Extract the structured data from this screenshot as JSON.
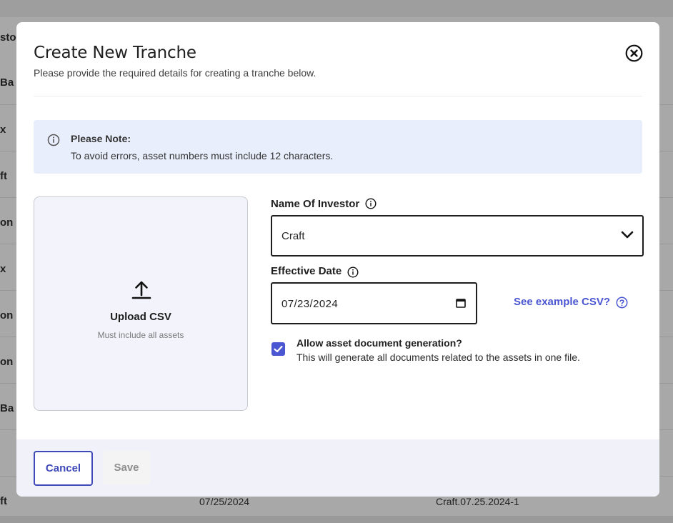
{
  "background_table": {
    "header_fragment": "sto",
    "row_fragments": [
      "Ba",
      "x",
      "ft",
      "on",
      "x",
      "on",
      "on",
      "Ba",
      "",
      "ft"
    ],
    "bottom_row": {
      "date": "07/25/2024",
      "tranche": "Craft.07.25.2024-1"
    }
  },
  "modal": {
    "title": "Create New Tranche",
    "subtitle": "Please provide the required details for creating a tranche below.",
    "close_icon": "close-circle-icon",
    "note": {
      "icon": "info-icon",
      "title": "Please Note:",
      "text": "To avoid errors, asset numbers must include 12 characters."
    },
    "upload": {
      "icon": "upload-icon",
      "title": "Upload CSV",
      "subtitle": "Must include all assets"
    },
    "investor": {
      "label": "Name Of Investor",
      "selected": "Craft"
    },
    "effective_date": {
      "label": "Effective Date",
      "value": "07/23/2024"
    },
    "example_link": "See example CSV?",
    "allow_generation": {
      "checked": true,
      "title": "Allow asset document generation?",
      "description": "This will generate all documents related to the assets in one file."
    },
    "footer": {
      "cancel_label": "Cancel",
      "save_label": "Save"
    }
  },
  "colors": {
    "accent": "#4b56d2",
    "note_bg": "#e8eefc",
    "footer_bg": "#f1f1fa"
  }
}
